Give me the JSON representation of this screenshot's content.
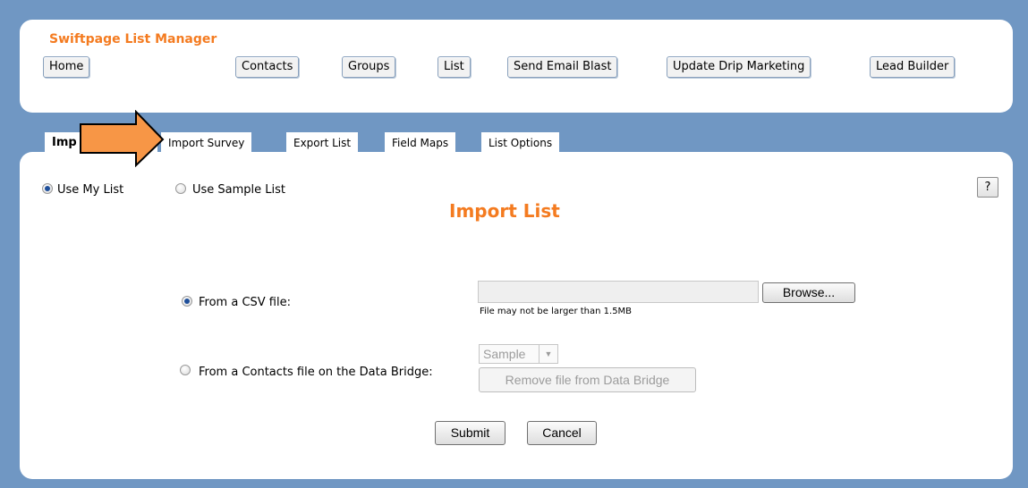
{
  "app": {
    "title": "Swiftpage  List Manager"
  },
  "nav": {
    "home": "Home",
    "contacts": "Contacts",
    "groups": "Groups",
    "list": "List",
    "send_email_blast": "Send Email Blast",
    "update_drip": "Update Drip Marketing",
    "lead_builder": "Lead Builder"
  },
  "tabs": {
    "import_list": "Import List",
    "import_list_visible": "Imp",
    "import_survey": "Import Survey",
    "export_list": "Export List",
    "field_maps": "Field Maps",
    "list_options": "List Options"
  },
  "list_source": {
    "use_my_list": "Use My List",
    "use_sample_list": "Use Sample List",
    "selected": "Use My List"
  },
  "help": {
    "label": "?"
  },
  "main": {
    "heading": "Import List"
  },
  "import_options": {
    "csv_label": "From a CSV file:",
    "browse_label": "Browse...",
    "file_value": "",
    "file_note": "File may not be larger than 1.5MB",
    "data_bridge_label": "From a Contacts file on the Data Bridge:",
    "data_bridge_select": "Sample",
    "remove_label": "Remove file from Data Bridge",
    "selected": "From a CSV file:"
  },
  "actions": {
    "submit": "Submit",
    "cancel": "Cancel"
  },
  "colors": {
    "background": "#7097c3",
    "accent": "#f47b20",
    "arrow_fill": "#f79646"
  },
  "annotation": {
    "icon": "arrow-right-icon"
  }
}
